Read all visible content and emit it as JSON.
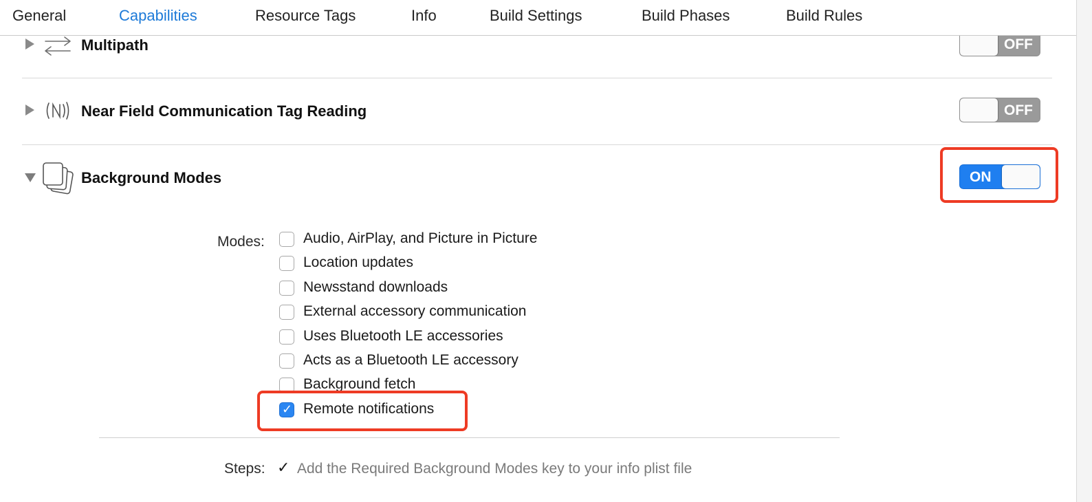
{
  "tabs": {
    "general": "General",
    "capabilities": "Capabilities",
    "resource_tags": "Resource Tags",
    "info": "Info",
    "build_settings": "Build Settings",
    "build_phases": "Build Phases",
    "build_rules": "Build Rules",
    "active": "Capabilities"
  },
  "capabilities": {
    "multipath": {
      "title": "Multipath",
      "state": "OFF",
      "icon": "multipath-arrows-icon"
    },
    "nfc": {
      "title": "Near Field Communication Tag Reading",
      "state": "OFF",
      "icon": "nfc-icon"
    },
    "background_modes": {
      "title": "Background Modes",
      "state": "ON",
      "icon": "stacked-windows-icon"
    }
  },
  "modes": {
    "label": "Modes:",
    "items": [
      {
        "label": "Audio, AirPlay, and Picture in Picture",
        "checked": false
      },
      {
        "label": "Location updates",
        "checked": false
      },
      {
        "label": "Newsstand downloads",
        "checked": false
      },
      {
        "label": "External accessory communication",
        "checked": false
      },
      {
        "label": "Uses Bluetooth LE accessories",
        "checked": false
      },
      {
        "label": "Acts as a Bluetooth LE accessory",
        "checked": false
      },
      {
        "label": "Background fetch",
        "checked": false
      },
      {
        "label": "Remote notifications",
        "checked": true
      }
    ]
  },
  "steps": {
    "label": "Steps:",
    "items": [
      "Add the Required Background Modes key to your info plist file"
    ]
  },
  "colors": {
    "accent": "#1d7ad8",
    "switch_on": "#1f7ff0",
    "highlight": "#ee3b24"
  }
}
